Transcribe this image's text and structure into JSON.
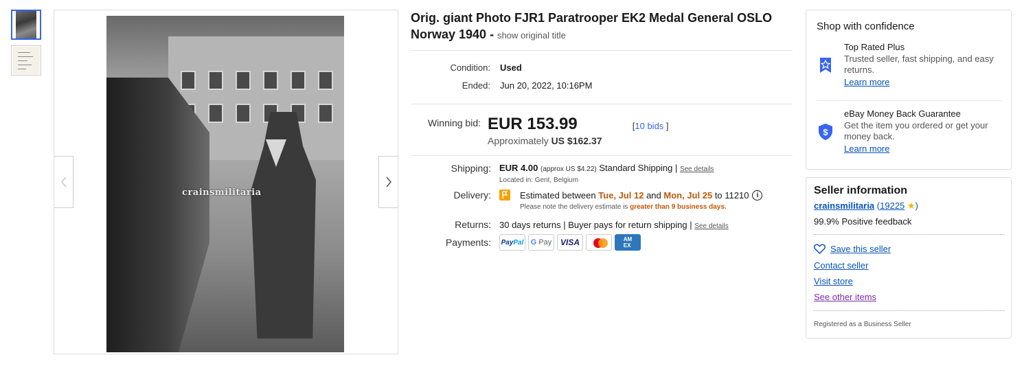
{
  "gallery": {
    "thumbnails": [
      "photo",
      "document"
    ],
    "watermark": "crainsmilitaria"
  },
  "listing": {
    "title": "Orig. giant Photo FJR1 Paratrooper EK2 Medal General OSLO Norway 1940 -",
    "show_original": "show original title",
    "condition_label": "Condition:",
    "condition_value": "Used",
    "ended_label": "Ended:",
    "ended_value": "Jun 20, 2022, 10:16PM",
    "winning_label": "Winning bid:",
    "winning_amount": "EUR 153.99",
    "approx_prefix": "Approximately",
    "approx_value": "US $162.37",
    "bids_open": "[",
    "bids_link": "10 bids",
    "bids_close": "]",
    "shipping_label": "Shipping:",
    "shipping_amount": "EUR 4.00",
    "shipping_approx": "(approx US $4.22)",
    "shipping_method": "Standard Shipping |",
    "see_details": "See details",
    "located": "Located in: Gent, Belgium",
    "delivery_label": "Delivery:",
    "delivery_text1": "Estimated between",
    "delivery_date1": "Tue, Jul 12",
    "delivery_and": "and",
    "delivery_date2": "Mon, Jul 25",
    "delivery_to": "to 11210",
    "delivery_note1": "Please note the delivery estimate is",
    "delivery_note2": "greater than 9 business days.",
    "returns_label": "Returns:",
    "returns_value": "30 days returns | Buyer pays for return shipping |",
    "returns_details": "See details",
    "payments_label": "Payments:",
    "payment_methods": [
      "PayPal",
      "G Pay",
      "VISA",
      "Mastercard",
      "AMEX"
    ]
  },
  "confidence": {
    "heading": "Shop with confidence",
    "top_rated_title": "Top Rated Plus",
    "top_rated_desc": "Trusted seller, fast shipping, and easy returns.",
    "top_rated_link": "Learn more",
    "money_back_title": "eBay Money Back Guarantee",
    "money_back_desc": "Get the item you ordered or get your money back.",
    "money_back_link": "Learn more"
  },
  "seller": {
    "heading": "Seller information",
    "name": "crainsmilitaria",
    "feedback_count": "19225",
    "positive": "99.9% Positive feedback",
    "save": "Save this seller",
    "contact": "Contact seller",
    "visit_store": "Visit store",
    "other_items": "See other items",
    "registered": "Registered as a Business Seller"
  },
  "colors": {
    "link": "#0654ba",
    "accent": "#3665f3",
    "orange": "#c0590b"
  }
}
